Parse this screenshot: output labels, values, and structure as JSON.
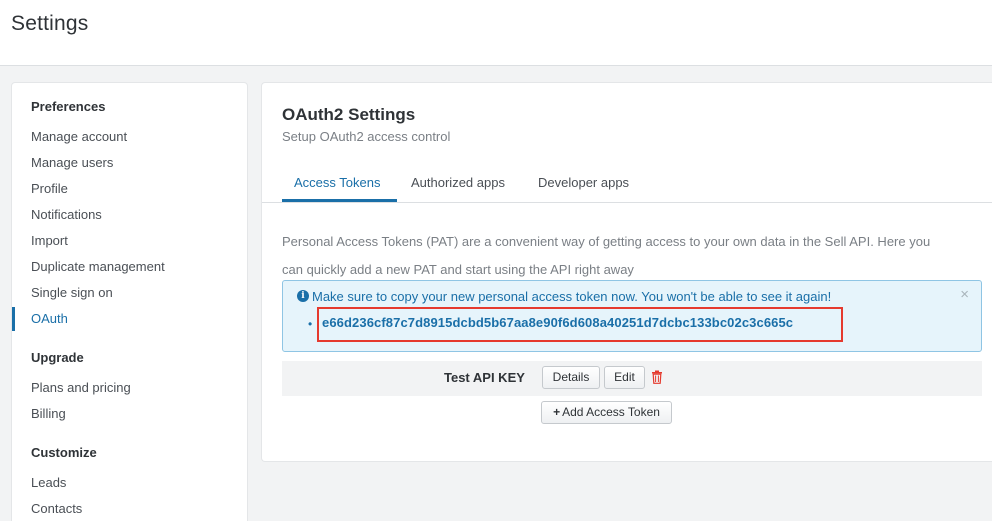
{
  "header": {
    "title": "Settings"
  },
  "sidebar": {
    "sections": [
      {
        "title": "Preferences",
        "items": [
          "Manage account",
          "Manage users",
          "Profile",
          "Notifications",
          "Import",
          "Duplicate management",
          "Single sign on",
          "OAuth"
        ]
      },
      {
        "title": "Upgrade",
        "items": [
          "Plans and pricing",
          "Billing"
        ]
      },
      {
        "title": "Customize",
        "items": [
          "Leads",
          "Contacts"
        ]
      }
    ],
    "active_item": "OAuth"
  },
  "main": {
    "title": "OAuth2 Settings",
    "subtitle": "Setup OAuth2 access control",
    "tabs": [
      {
        "label": "Access Tokens",
        "active": true
      },
      {
        "label": "Authorized apps",
        "active": false
      },
      {
        "label": "Developer apps",
        "active": false
      }
    ],
    "description_line1": "Personal Access Tokens (PAT) are a convenient way of getting access to your own data in the Sell API. Here you",
    "description_line2": "can quickly add a new PAT and start using the API right away",
    "alert": {
      "message": "Make sure to copy your new personal access token now. You won't be able to see it again!",
      "close": "×",
      "token": "e66d236cf87c7d8915dcbd5b67aa8e90f6d608a40251d7dcbc133bc02c3c665c"
    },
    "token_row": {
      "name": "Test API KEY",
      "details_label": "Details",
      "edit_label": "Edit"
    },
    "add_token_label": "Add Access Token"
  },
  "colors": {
    "accent": "#1a6fa8",
    "alert_bg": "#e6f4fb",
    "highlight": "#e53a2e",
    "delete": "#e53a2e"
  }
}
